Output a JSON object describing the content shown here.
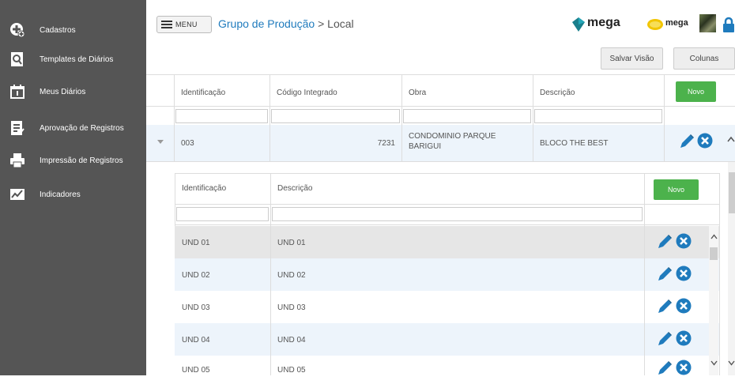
{
  "sidebar": {
    "items": [
      {
        "label": "Cadastros",
        "icon": "add-circle-icon"
      },
      {
        "label": "Templates de Diários",
        "icon": "search-document-icon"
      },
      {
        "label": "Meus Diários",
        "icon": "calendar-icon"
      },
      {
        "label": "Aprovação de Registros",
        "icon": "checklist-icon"
      },
      {
        "label": "Impressão de Registros",
        "icon": "printer-icon"
      },
      {
        "label": "Indicadores",
        "icon": "chart-icon"
      }
    ]
  },
  "header": {
    "menu_label": "MENU",
    "breadcrumb_link": "Grupo de Produção",
    "breadcrumb_sep": ">",
    "breadcrumb_current": "Local",
    "logo1_text": "mega",
    "logo2_text": "mega"
  },
  "toolbar": {
    "save_view": "Salvar Visão",
    "columns": "Colunas"
  },
  "grid": {
    "columns": [
      "Identificação",
      "Código Integrado",
      "Obra",
      "Descrição"
    ],
    "new_label": "Novo",
    "row": {
      "id": "003",
      "codigo": "7231",
      "obra_line1": "CONDOMINIO PARQUE",
      "obra_line2": "BARIGUI",
      "descricao": "BLOCO THE BEST"
    }
  },
  "subgrid": {
    "columns": [
      "Identificação",
      "Descrição"
    ],
    "new_label": "Novo",
    "rows": [
      {
        "id": "UND 01",
        "desc": "UND 01"
      },
      {
        "id": "UND 02",
        "desc": "UND 02"
      },
      {
        "id": "UND 03",
        "desc": "UND 03"
      },
      {
        "id": "UND 04",
        "desc": "UND 04"
      },
      {
        "id": "UND 05",
        "desc": "UND 05"
      }
    ]
  },
  "colors": {
    "sidebar_bg": "#555555",
    "accent_green": "#4cb24c",
    "accent_blue": "#1f7bbd",
    "selected_row": "#e6e6e6",
    "alt_row": "#edf4fb"
  }
}
